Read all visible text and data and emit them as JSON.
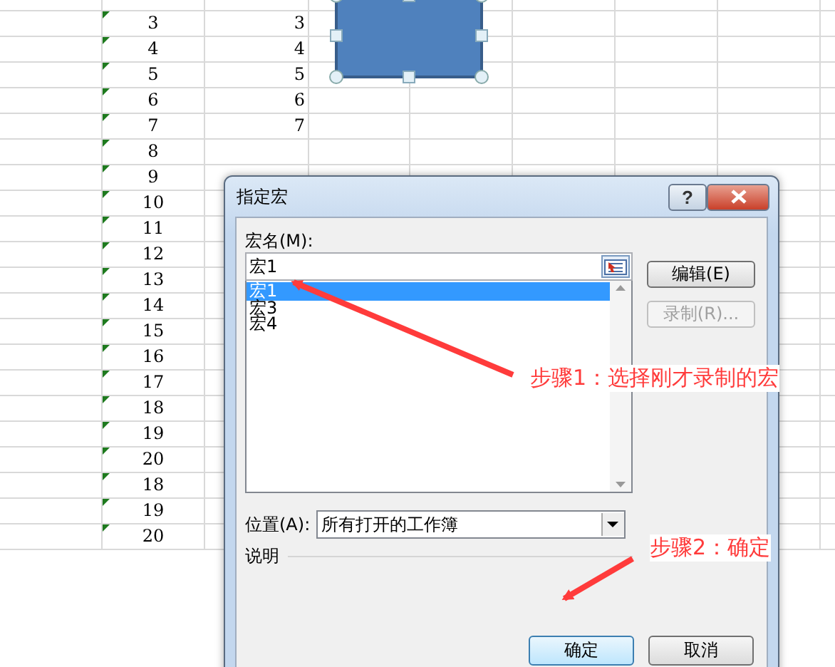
{
  "sheet": {
    "rows": [
      {
        "col_b": "",
        "col_c": ""
      },
      {
        "col_b": "3",
        "col_c": "3"
      },
      {
        "col_b": "4",
        "col_c": "4"
      },
      {
        "col_b": "5",
        "col_c": "5"
      },
      {
        "col_b": "6",
        "col_c": "6"
      },
      {
        "col_b": "7",
        "col_c": "7"
      },
      {
        "col_b": "8",
        "col_c": ""
      },
      {
        "col_b": "9",
        "col_c": ""
      },
      {
        "col_b": "10",
        "col_c": ""
      },
      {
        "col_b": "11",
        "col_c": ""
      },
      {
        "col_b": "12",
        "col_c": ""
      },
      {
        "col_b": "13",
        "col_c": ""
      },
      {
        "col_b": "14",
        "col_c": ""
      },
      {
        "col_b": "15",
        "col_c": ""
      },
      {
        "col_b": "16",
        "col_c": ""
      },
      {
        "col_b": "17",
        "col_c": ""
      },
      {
        "col_b": "18",
        "col_c": ""
      },
      {
        "col_b": "19",
        "col_c": ""
      },
      {
        "col_b": "20",
        "col_c": ""
      },
      {
        "col_b": "18",
        "col_c": ""
      },
      {
        "col_b": "19",
        "col_c": ""
      },
      {
        "col_b": "20",
        "col_c": ""
      }
    ]
  },
  "dialog": {
    "title": "指定宏",
    "help": "?",
    "macro_name_label": "宏名(M):",
    "macro_name_value": "宏1",
    "macros": [
      {
        "label": "宏1",
        "selected": true
      },
      {
        "label": "宏3",
        "selected": false
      },
      {
        "label": "宏4",
        "selected": false
      }
    ],
    "side_buttons": [
      {
        "label": "编辑(E)",
        "disabled": false
      },
      {
        "label": "录制(R)...",
        "disabled": true
      }
    ],
    "location_label": "位置(A):",
    "location_value": "所有打开的工作簿",
    "description_label": "说明",
    "buttons": [
      {
        "label": "确定",
        "default": true
      },
      {
        "label": "取消",
        "default": false
      }
    ]
  },
  "annotations": [
    {
      "text": "步骤1：选择刚才录制的宏"
    },
    {
      "text": "步骤2：确定"
    }
  ]
}
